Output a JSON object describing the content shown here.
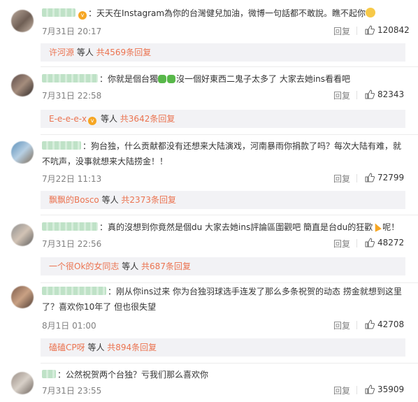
{
  "comments": [
    {
      "text": "：天天在Instagram為你的台灣健兒加油，微博一句話都不敢說。瞧不起你",
      "date": "7月31日 20:17",
      "reply_label": "回复",
      "likes": "120842",
      "reply_user": "许河源",
      "reply_mid": " 等人 ",
      "reply_count": "共4569条回复"
    },
    {
      "text_a": "：你就是個台獨",
      "text_b": "沒一個好東西二鬼子太多了 大家去她ins看看吧",
      "date": "7月31日 22:58",
      "reply_label": "回复",
      "likes": "82343",
      "reply_user": "E-e-e-e-x",
      "reply_mid": " 等人 ",
      "reply_count": "共3642条回复"
    },
    {
      "line1": "：狗台独，什么贡献都没有还想来大陆演戏，河南暴雨你捐款了吗？每次大陆有难，就",
      "line2": "不吭声，没事就想来大陆捞金！！",
      "date": "7月22日 11:13",
      "reply_label": "回复",
      "likes": "72799",
      "reply_user": "飘飘的Bosco",
      "reply_mid": " 等人 ",
      "reply_count": "共2373条回复"
    },
    {
      "text_a": "：真的沒想到你竟然是個du 大家去她ins評論區圍觀吧 簡直是台du的狂歡",
      "text_b": "呢！",
      "date": "7月31日 22:56",
      "reply_label": "回复",
      "likes": "48272",
      "reply_user": "一个很Ok的女同志",
      "reply_mid": " 等人 ",
      "reply_count": "共687条回复"
    },
    {
      "line1": "：刚从你ins过来 你为台独羽球选手连发了那么多条祝贺的动态 捞金就想到这里",
      "line2": "了？喜欢你10年了 但也很失望",
      "date": "8月1日 01:00",
      "reply_label": "回复",
      "likes": "42708",
      "reply_user": "磕磕CP呀",
      "reply_mid": " 等人 ",
      "reply_count": "共894条回复"
    },
    {
      "text": "：公然祝贺两个台独？亏我们那么喜欢你",
      "date": "7月31日 23:55",
      "reply_label": "回复",
      "likes": "35909"
    }
  ],
  "colors": {
    "accent": "#eb7350",
    "meta": "#808080",
    "replybox_bg": "#f2f2f5"
  },
  "icons": {
    "like": "thumbs-up-icon",
    "vip": "vip-badge-icon"
  }
}
